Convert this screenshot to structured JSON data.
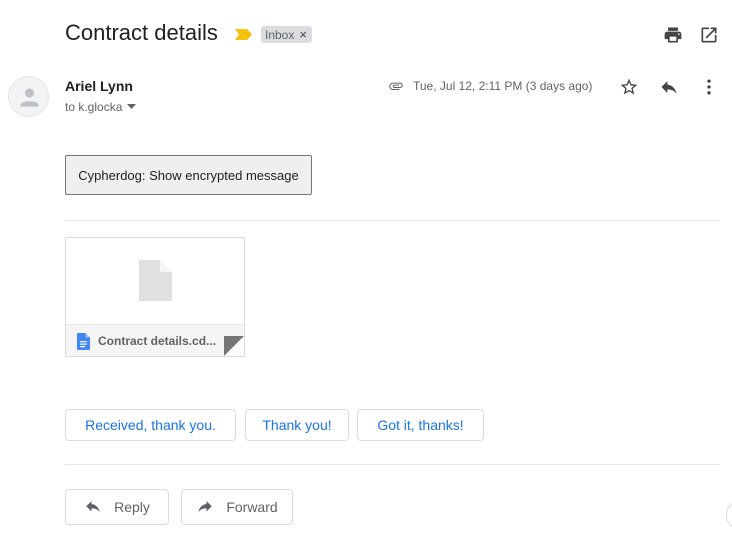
{
  "email": {
    "subject": "Contract details",
    "label": "Inbox",
    "label_remove": "×",
    "sender_name": "Ariel Lynn",
    "recipient": "to k.glocka",
    "date": "Tue, Jul 12, 2:11 PM (3 days ago)"
  },
  "extension": {
    "button_label": "Cypherdog: Show encrypted message"
  },
  "attachment": {
    "file_name": "Contract details.cd..."
  },
  "smart_replies": [
    "Received, thank you.",
    "Thank you!",
    "Got it, thanks!"
  ],
  "actions": {
    "reply": "Reply",
    "forward": "Forward"
  },
  "icons": {
    "importance": "importance-marker-icon",
    "print": "print-icon",
    "new_window": "open-in-new-window-icon",
    "attachment": "paperclip-icon",
    "star": "star-icon",
    "reply": "reply-icon",
    "more": "more-vert-icon",
    "avatar": "person-icon",
    "recipient_details": "caret-down-icon",
    "file": "file-icon",
    "doc": "doc-icon"
  },
  "colors": {
    "importance": "#f4c20d",
    "link_blue": "#1a73e8",
    "doc_icon_blue": "#4285f4"
  }
}
